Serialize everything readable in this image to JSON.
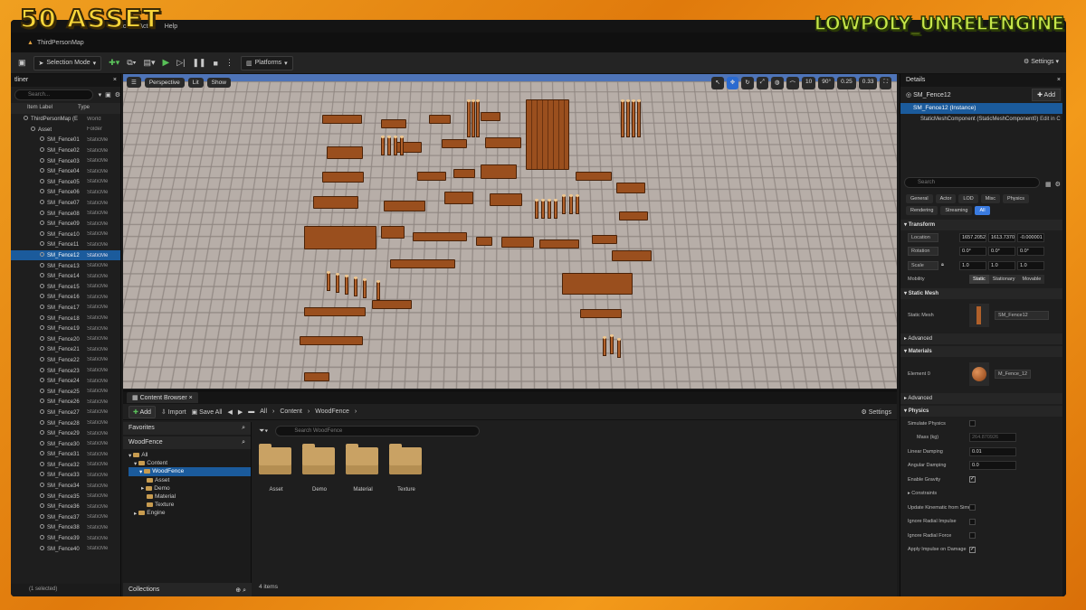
{
  "banner": {
    "left": "50 ASSET",
    "right": "LOWPOLY_UNRELENGINE"
  },
  "menu": [
    "ect",
    "Actor",
    "Help"
  ],
  "map_tab": "ThirdPersonMap",
  "toolbar": {
    "selection_mode": "Selection Mode",
    "platforms": "Platforms",
    "settings": "Settings"
  },
  "outliner": {
    "title": "tliner",
    "search": "Search...",
    "col_label": "Item Label",
    "col_type": "Type",
    "rows": [
      {
        "name": "ThirdPersonMap (E",
        "type": "World"
      },
      {
        "name": "Asset",
        "type": "Folder"
      },
      {
        "name": "SM_Fence01",
        "type": "StaticMe"
      },
      {
        "name": "SM_Fence02",
        "type": "StaticMe"
      },
      {
        "name": "SM_Fence03",
        "type": "StaticMe"
      },
      {
        "name": "SM_Fence04",
        "type": "StaticMe"
      },
      {
        "name": "SM_Fence05",
        "type": "StaticMe"
      },
      {
        "name": "SM_Fence06",
        "type": "StaticMe"
      },
      {
        "name": "SM_Fence07",
        "type": "StaticMe"
      },
      {
        "name": "SM_Fence08",
        "type": "StaticMe"
      },
      {
        "name": "SM_Fence09",
        "type": "StaticMe"
      },
      {
        "name": "SM_Fence10",
        "type": "StaticMe"
      },
      {
        "name": "SM_Fence11",
        "type": "StaticMe"
      },
      {
        "name": "SM_Fence12",
        "type": "StaticMe"
      },
      {
        "name": "SM_Fence13",
        "type": "StaticMe"
      },
      {
        "name": "SM_Fence14",
        "type": "StaticMe"
      },
      {
        "name": "SM_Fence15",
        "type": "StaticMe"
      },
      {
        "name": "SM_Fence16",
        "type": "StaticMe"
      },
      {
        "name": "SM_Fence17",
        "type": "StaticMe"
      },
      {
        "name": "SM_Fence18",
        "type": "StaticMe"
      },
      {
        "name": "SM_Fence19",
        "type": "StaticMe"
      },
      {
        "name": "SM_Fence20",
        "type": "StaticMe"
      },
      {
        "name": "SM_Fence21",
        "type": "StaticMe"
      },
      {
        "name": "SM_Fence22",
        "type": "StaticMe"
      },
      {
        "name": "SM_Fence23",
        "type": "StaticMe"
      },
      {
        "name": "SM_Fence24",
        "type": "StaticMe"
      },
      {
        "name": "SM_Fence25",
        "type": "StaticMe"
      },
      {
        "name": "SM_Fence26",
        "type": "StaticMe"
      },
      {
        "name": "SM_Fence27",
        "type": "StaticMe"
      },
      {
        "name": "SM_Fence28",
        "type": "StaticMe"
      },
      {
        "name": "SM_Fence29",
        "type": "StaticMe"
      },
      {
        "name": "SM_Fence30",
        "type": "StaticMe"
      },
      {
        "name": "SM_Fence31",
        "type": "StaticMe"
      },
      {
        "name": "SM_Fence32",
        "type": "StaticMe"
      },
      {
        "name": "SM_Fence33",
        "type": "StaticMe"
      },
      {
        "name": "SM_Fence34",
        "type": "StaticMe"
      },
      {
        "name": "SM_Fence35",
        "type": "StaticMe"
      },
      {
        "name": "SM_Fence36",
        "type": "StaticMe"
      },
      {
        "name": "SM_Fence37",
        "type": "StaticMe"
      },
      {
        "name": "SM_Fence38",
        "type": "StaticMe"
      },
      {
        "name": "SM_Fence39",
        "type": "StaticMe"
      },
      {
        "name": "SM_Fence40",
        "type": "StaticMe"
      }
    ],
    "selected_index": 13,
    "footer": "(1 selected)"
  },
  "viewport": {
    "perspective": "Perspective",
    "lit": "Lit",
    "show": "Show",
    "grid": "10",
    "angle": "90°",
    "scale": "0.25",
    "cam": "0.33"
  },
  "content_browser": {
    "tab": "Content Browser",
    "add": "Add",
    "import": "Import",
    "save_all": "Save All",
    "crumbs": [
      "All",
      "Content",
      "WoodFence"
    ],
    "settings": "Settings",
    "favorites": "Favorites",
    "root": "WoodFence",
    "tree": [
      "All",
      "Content",
      "WoodFence",
      "Asset",
      "Demo",
      "Material",
      "Texture",
      "Engine"
    ],
    "search": "Search WoodFence",
    "folders": [
      "Asset",
      "Demo",
      "Material",
      "Texture"
    ],
    "count": "4 items",
    "collections": "Collections"
  },
  "details": {
    "title": "Details",
    "object": "SM_Fence12",
    "add": "Add",
    "instance": "SM_Fence12 (Instance)",
    "component": "StaticMeshComponent (StaticMeshComponent0)",
    "edit": "Edit in C",
    "search": "Search",
    "tabs": [
      "General",
      "Actor",
      "LOD",
      "Misc",
      "Physics",
      "Rendering",
      "Streaming",
      "All"
    ],
    "transform": "Transform",
    "location_label": "Location",
    "location": [
      "1657.20524",
      "1613.73708",
      "-0.000001"
    ],
    "rotation_label": "Rotation",
    "rotation": [
      "0.0°",
      "0.0°",
      "0.0°"
    ],
    "scale_label": "Scale",
    "scale": [
      "1.0",
      "1.0",
      "1.0"
    ],
    "mobility": "Mobility",
    "mobility_opts": [
      "Static",
      "Stationary",
      "Movable"
    ],
    "static_mesh_sec": "Static Mesh",
    "static_mesh_label": "Static Mesh",
    "static_mesh_value": "SM_Fence12",
    "advanced": "Advanced",
    "materials_sec": "Materials",
    "element0": "Element 0",
    "material_value": "M_Fence_12",
    "physics_sec": "Physics",
    "simulate": "Simulate Physics",
    "mass_label": "Mass (kg)",
    "mass": "264.870926",
    "linear": "Linear Damping",
    "linear_v": "0.01",
    "angular": "Angular Damping",
    "angular_v": "0.0",
    "gravity": "Enable Gravity",
    "constraints": "Constraints",
    "kinematic": "Update Kinematic from Simula...",
    "radial_impulse": "Ignore Radial Impulse",
    "radial_force": "Ignore Radial Force",
    "apply_impulse": "Apply Impulse on Damage"
  }
}
